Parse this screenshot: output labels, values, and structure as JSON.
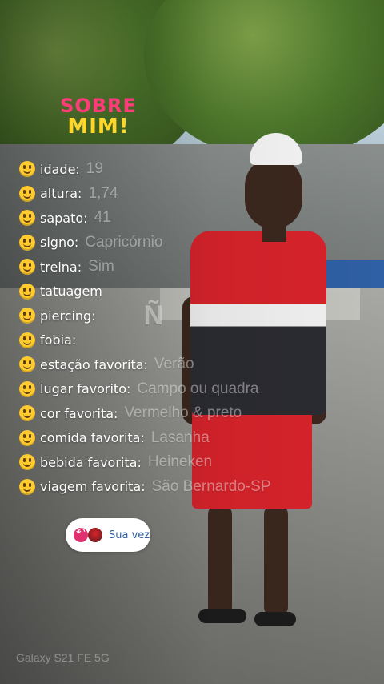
{
  "title": {
    "line1": "SOBRE",
    "line2": "MIM!"
  },
  "items": [
    {
      "label": "idade:",
      "value": "19"
    },
    {
      "label": "altura:",
      "value": "1,74"
    },
    {
      "label": "sapato:",
      "value": "41"
    },
    {
      "label": "signo:",
      "value": "Capricórnio"
    },
    {
      "label": "treina:",
      "value": "Sim"
    },
    {
      "label": "tatuagem",
      "value": ""
    },
    {
      "label": "piercing:",
      "value": "Ñ"
    },
    {
      "label": "fobia:",
      "value": ""
    },
    {
      "label": "estação favorita:",
      "value": "Verão"
    },
    {
      "label": "lugar favorito:",
      "value": "Campo ou quadra"
    },
    {
      "label": "cor favorita:",
      "value": "Vermelho & preto"
    },
    {
      "label": "comida favorita:",
      "value": "Lasanha"
    },
    {
      "label": "bebida favorita:",
      "value": "Heineken"
    },
    {
      "label": "viagem favorita:",
      "value": "São Bernardo-SP"
    }
  ],
  "reply_button": {
    "label": "Sua vez",
    "icon": "reply-arrow-icon"
  },
  "watermark": "Galaxy S21 FE 5G",
  "colors": {
    "title1": "#ff3b79",
    "title2": "#ffd629",
    "emoji": "#ffcb2e",
    "accent": "#2f5fa4"
  }
}
